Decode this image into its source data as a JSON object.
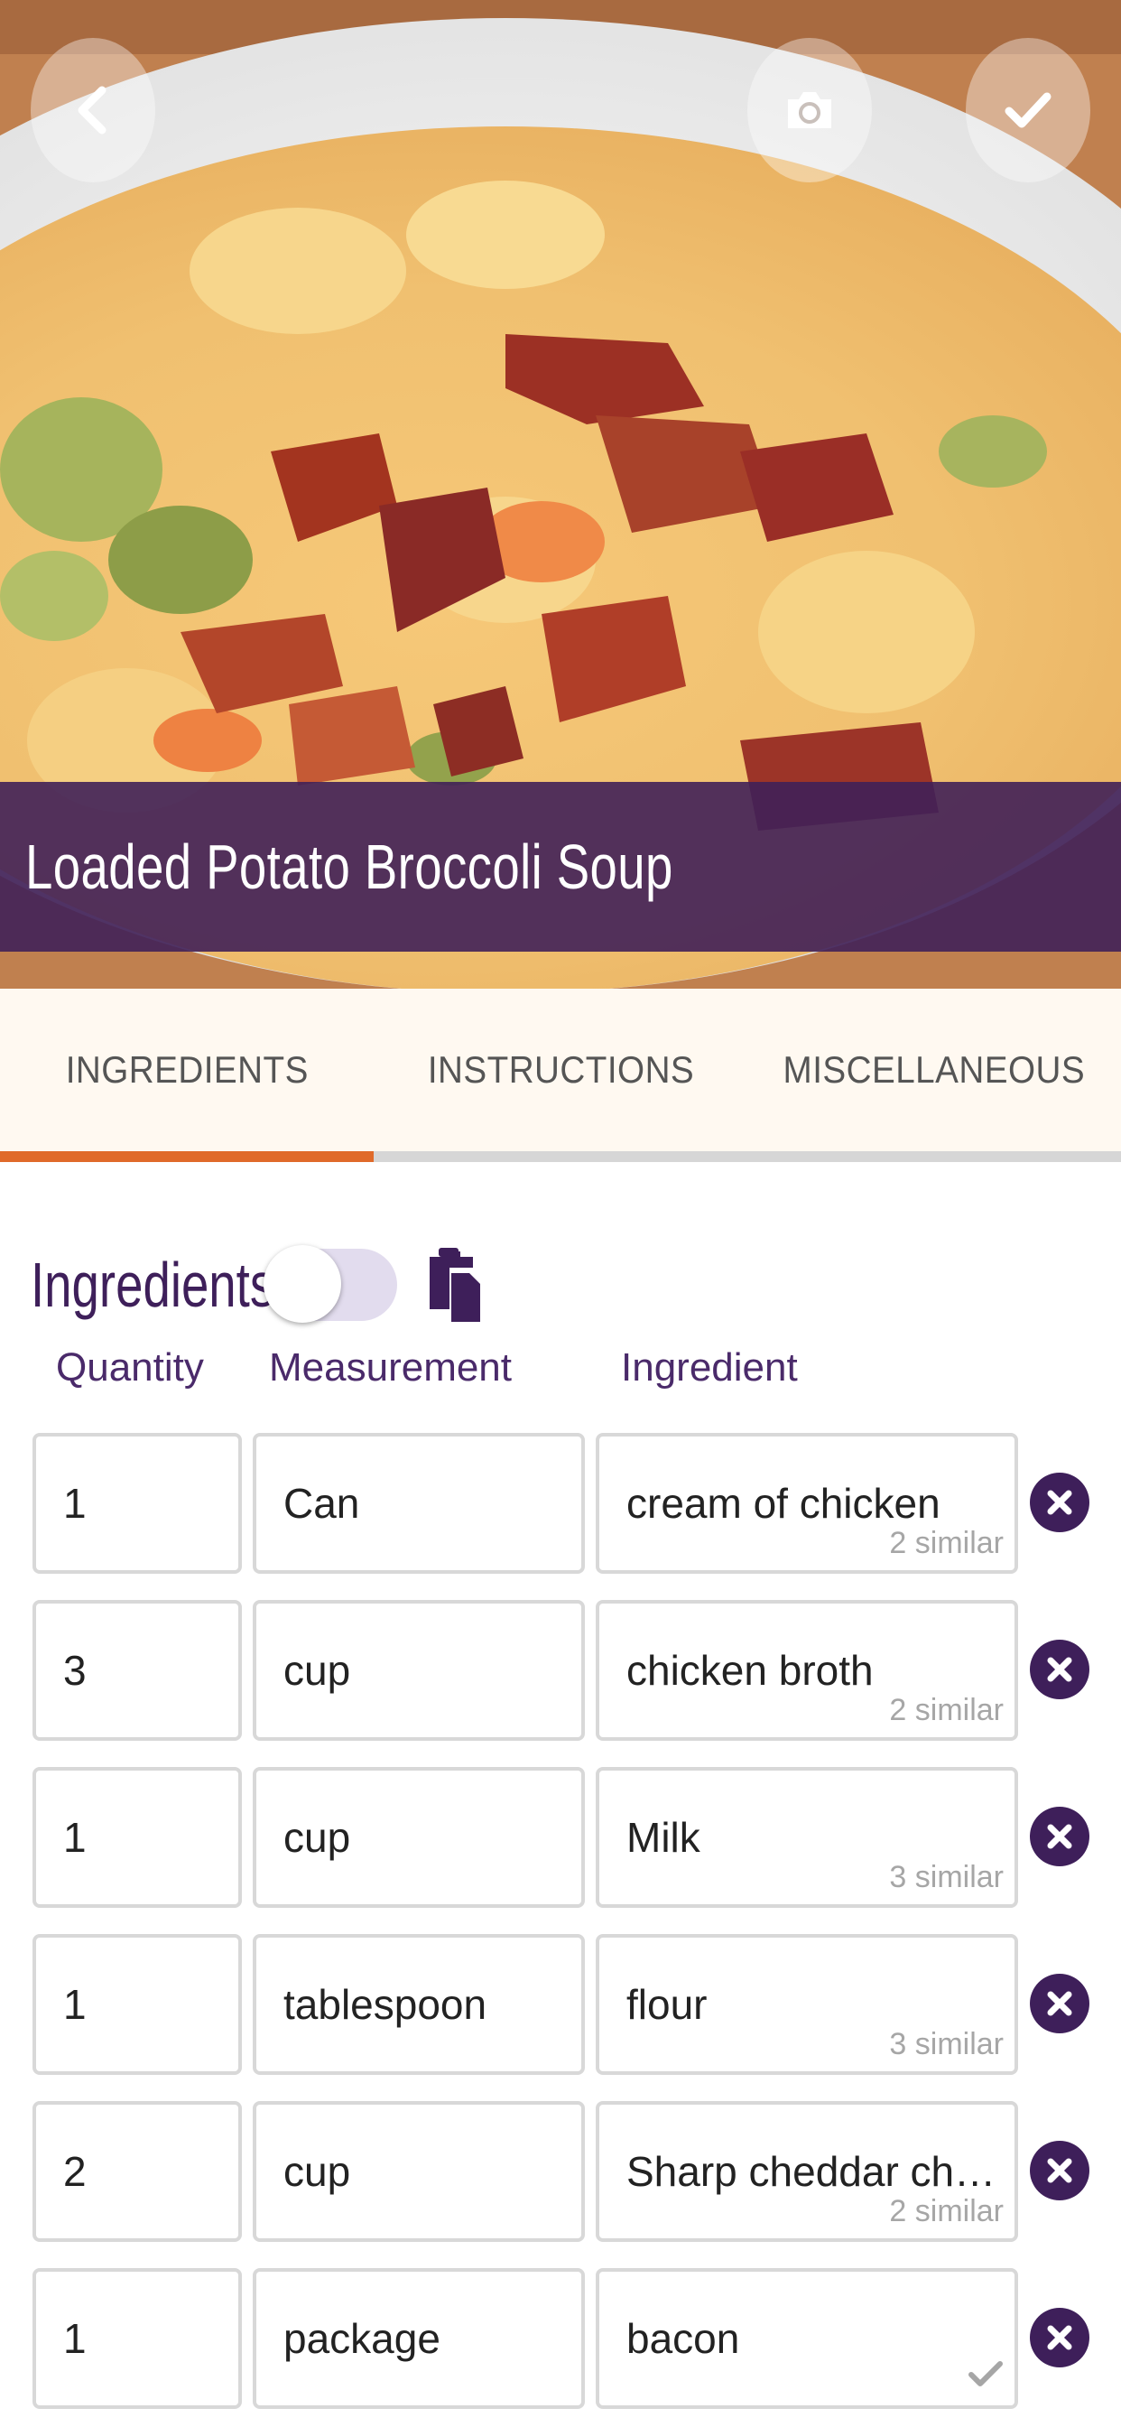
{
  "header": {
    "back_icon": "chevron-left-icon",
    "camera_icon": "camera-icon",
    "save_icon": "checkmark-icon",
    "recipe_title": "Loaded Potato Broccoli Soup"
  },
  "tabs": [
    {
      "label": "INGREDIENTS",
      "active": true
    },
    {
      "label": "INSTRUCTIONS",
      "active": false
    },
    {
      "label": "MISCELLANEOUS",
      "active": false
    }
  ],
  "ingredients_section": {
    "title": "Ingredients",
    "toggle_on": false,
    "paste_icon": "clipboard-paste-icon",
    "columns": {
      "quantity": "Quantity",
      "measurement": "Measurement",
      "ingredient": "Ingredient"
    },
    "rows": [
      {
        "quantity": "1",
        "measurement": "Can",
        "ingredient": "cream of chicken",
        "similar": "2 similar"
      },
      {
        "quantity": "3",
        "measurement": "cup",
        "ingredient": "chicken broth",
        "similar": "2 similar"
      },
      {
        "quantity": "1",
        "measurement": "cup",
        "ingredient": "Milk",
        "similar": "3 similar"
      },
      {
        "quantity": "1",
        "measurement": "tablespoon",
        "ingredient": "flour",
        "similar": "3 similar"
      },
      {
        "quantity": "2",
        "measurement": "cup",
        "ingredient": "Sharp cheddar che...",
        "similar": "2 similar"
      },
      {
        "quantity": "1",
        "measurement": "package",
        "ingredient": "bacon",
        "similar": ""
      }
    ]
  },
  "colors": {
    "brand_purple": "#3e1f5a",
    "tab_accent": "#e06a2a",
    "title_band": "#402058"
  }
}
